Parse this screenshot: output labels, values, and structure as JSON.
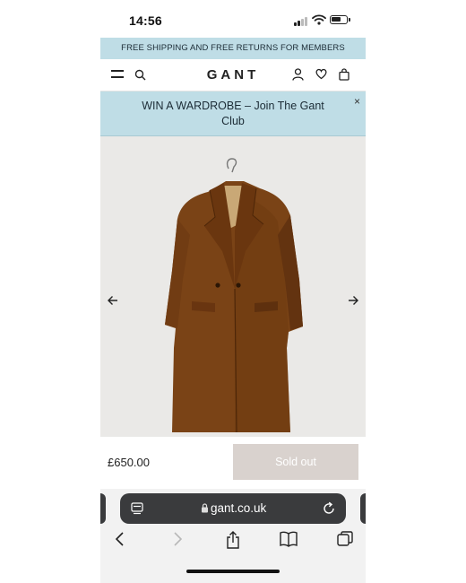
{
  "status_bar": {
    "time": "14:56"
  },
  "banner": {
    "text": "FREE SHIPPING AND FREE RETURNS FOR MEMBERS"
  },
  "nav": {
    "logo": "GANT"
  },
  "promo": {
    "text": "WIN A WARDROBE – Join The Gant Club",
    "close": "×"
  },
  "product": {
    "price": "£650.00",
    "button": "Sold out"
  },
  "browser": {
    "url": "gant.co.uk"
  },
  "colors": {
    "banner": "#bfdde6",
    "coat": "#7a4316",
    "sold_out": "#d9d2ce",
    "url_bar": "#3a3b3d"
  },
  "icons": [
    "menu-icon",
    "search-icon",
    "user-icon",
    "heart-icon",
    "bag-icon",
    "close-icon",
    "arrow-left-icon",
    "arrow-right-icon",
    "tabs-overview-icon",
    "lock-icon",
    "reload-icon",
    "back-icon",
    "forward-icon",
    "share-icon",
    "bookmarks-icon",
    "tabs-icon"
  ]
}
